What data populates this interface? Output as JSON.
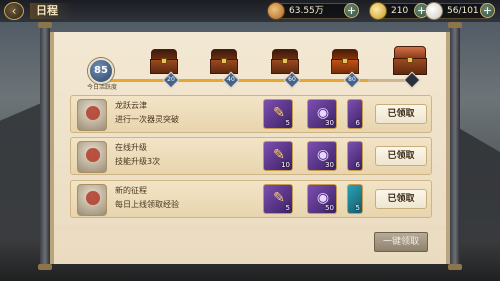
{
  "header": {
    "back_icon": "back-arrow-icon",
    "title": "日程"
  },
  "resources": [
    {
      "icon": "copper-coin-icon",
      "value": "63.55万"
    },
    {
      "icon": "gold-ingot-icon",
      "value": "210"
    },
    {
      "icon": "steamed-bun-icon",
      "value": "56/101"
    }
  ],
  "progress": {
    "score": "85",
    "score_label": "今日活跃度",
    "fill_fraction": 0.86,
    "milestones": [
      {
        "value": "20",
        "reached": true
      },
      {
        "value": "40",
        "reached": true
      },
      {
        "value": "60",
        "reached": true
      },
      {
        "value": "80",
        "reached": true
      },
      {
        "value": "",
        "reached": false
      }
    ]
  },
  "quests": [
    {
      "name": "龙跃云津",
      "desc": "进行一次器灵突破",
      "rewards": [
        {
          "icon": "scroll-item-icon",
          "count": "5"
        },
        {
          "icon": "spirit-orb-icon",
          "count": "30"
        },
        {
          "icon": "scroll-item-icon",
          "count": "6"
        }
      ],
      "status": "已领取"
    },
    {
      "name": "在线升级",
      "desc": "技能升级3次",
      "rewards": [
        {
          "icon": "scroll-item-icon",
          "count": "10"
        },
        {
          "icon": "spirit-orb-icon",
          "count": "30"
        },
        {
          "icon": "scroll-item-icon",
          "count": "6"
        }
      ],
      "status": "已领取"
    },
    {
      "name": "新的征程",
      "desc": "每日上线领取经验",
      "rewards": [
        {
          "icon": "scroll-item-icon",
          "count": "5"
        },
        {
          "icon": "spirit-orb-icon",
          "count": "50"
        },
        {
          "icon": "exp-book-icon",
          "count": "5"
        }
      ],
      "status": "已领取"
    }
  ],
  "footer": {
    "claim_all": "一键领取"
  }
}
